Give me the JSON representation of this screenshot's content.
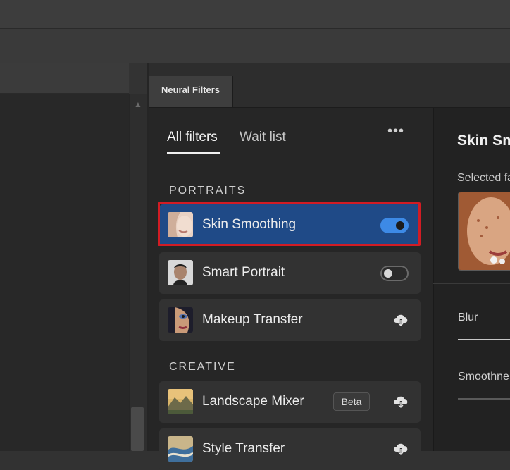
{
  "panel": {
    "tab_title": "Neural Filters"
  },
  "filter_tabs": {
    "all": "All filters",
    "wait": "Wait list",
    "more_icon": "ellipsis-icon"
  },
  "sections": {
    "portraits": "PORTRAITS",
    "creative": "CREATIVE"
  },
  "filters": [
    {
      "label": "Skin Smoothing",
      "state": "on",
      "selected": true
    },
    {
      "label": "Smart Portrait",
      "state": "off",
      "selected": false
    },
    {
      "label": "Makeup Transfer",
      "state": "cloud-download",
      "selected": false
    },
    {
      "label": "Landscape Mixer",
      "state": "cloud-download",
      "badge": "Beta",
      "selected": false
    },
    {
      "label": "Style Transfer",
      "state": "cloud-download",
      "selected": false
    }
  ],
  "detail": {
    "title": "Skin Sm",
    "selected_label": "Selected fa",
    "blur_label": "Blur",
    "smoothness_label": "Smoothne"
  },
  "colors": {
    "selected_item": "#1f4a87",
    "toggle_on": "#3d8ae6",
    "highlight_outline": "#d21c24"
  }
}
